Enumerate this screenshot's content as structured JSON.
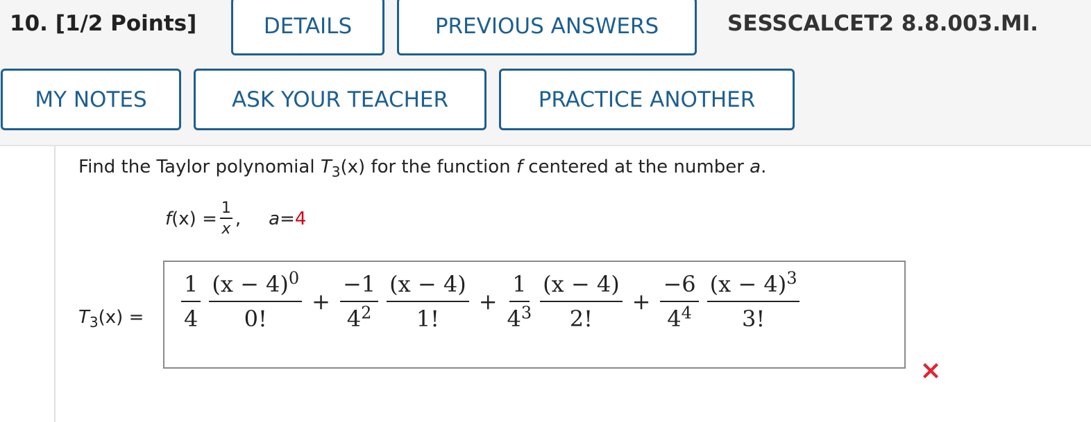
{
  "header": {
    "question_number": "10.",
    "points": "[1/2 Points]",
    "code": "SESSCALCET2 8.8.003.MI.",
    "buttons": {
      "details": "DETAILS",
      "previous_answers": "PREVIOUS ANSWERS",
      "my_notes": "MY NOTES",
      "ask_teacher": "ASK YOUR TEACHER",
      "practice_another": "PRACTICE ANOTHER"
    }
  },
  "question": {
    "prompt_before": "Find the Taylor polynomial ",
    "T": "T",
    "sub": "3",
    "arg": "(x)",
    "prompt_after": " for the function ",
    "f": "f",
    "prompt_after2": " centered at the number ",
    "a": "a",
    "period": ".",
    "fx_label": "f",
    "fx_arg": "(x) = ",
    "fx_num": "1",
    "fx_den": "x",
    "comma": ",",
    "a_label": "a",
    "a_eq": " = ",
    "a_value": "4"
  },
  "answer": {
    "label_T": "T",
    "label_sub": "3",
    "label_rest": "(x) =",
    "terms": [
      {
        "coef_num": "1",
        "coef_den": "4",
        "coef_den_exp": "",
        "pow_num": "(x − 4)",
        "pow_exp": "0",
        "fact": "0!"
      },
      {
        "coef_num": "−1",
        "coef_den": "4",
        "coef_den_exp": "2",
        "pow_num": "(x − 4)",
        "pow_exp": "",
        "fact": "1!"
      },
      {
        "coef_num": "1",
        "coef_den": "4",
        "coef_den_exp": "3",
        "pow_num": "(x − 4)",
        "pow_exp": "",
        "fact": "2!"
      },
      {
        "coef_num": "−6",
        "coef_den": "4",
        "coef_den_exp": "4",
        "pow_num": "(x − 4)",
        "pow_exp": "3",
        "fact": "3!"
      }
    ],
    "plus": "+",
    "status": "incorrect",
    "status_color": "#e0242f"
  }
}
